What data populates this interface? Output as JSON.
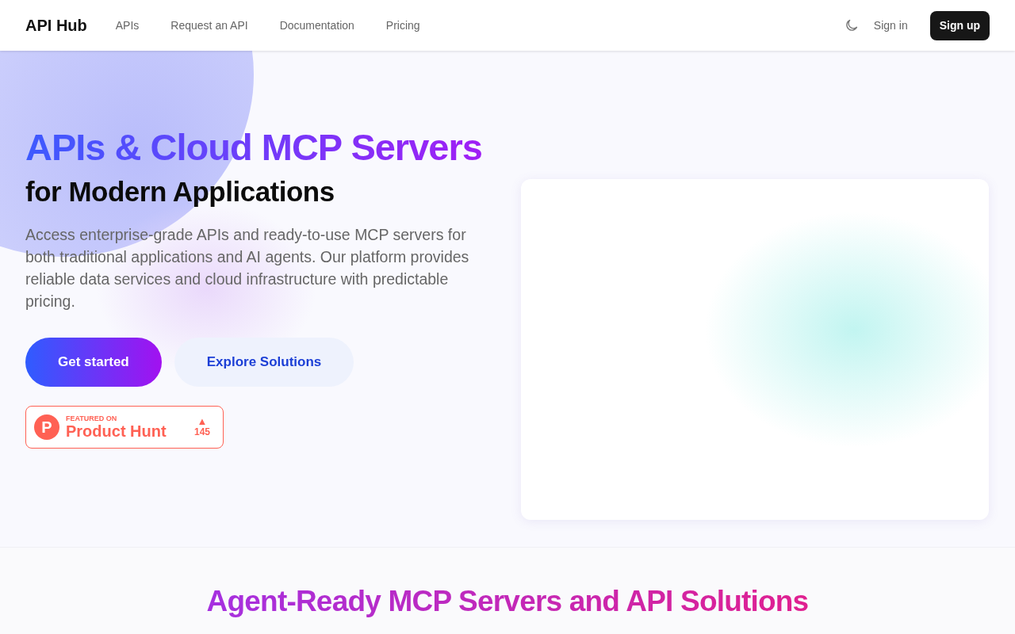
{
  "navbar": {
    "brand": "API Hub",
    "links": [
      {
        "label": "APIs"
      },
      {
        "label": "Request an API"
      },
      {
        "label": "Documentation"
      },
      {
        "label": "Pricing"
      }
    ],
    "sign_in": "Sign in",
    "sign_up": "Sign up"
  },
  "hero": {
    "title_gradient": "APIs & Cloud MCP Servers",
    "title_rest": "for Modern Applications",
    "description": "Access enterprise-grade APIs and ready-to-use MCP servers for both traditional applications and AI agents. Our platform provides reliable data services and cloud infrastructure with predictable pricing.",
    "buttons": [
      {
        "label": "Get started",
        "kind": "primary"
      },
      {
        "label": "Explore Solutions",
        "kind": "secondary"
      }
    ],
    "product_hunt": {
      "logo_letter": "P",
      "featured": "FEATURED ON",
      "name": "Product Hunt",
      "arrow": "▲",
      "votes": "145"
    }
  },
  "section": {
    "heading": "Agent-Ready MCP Servers and API Solutions"
  }
}
